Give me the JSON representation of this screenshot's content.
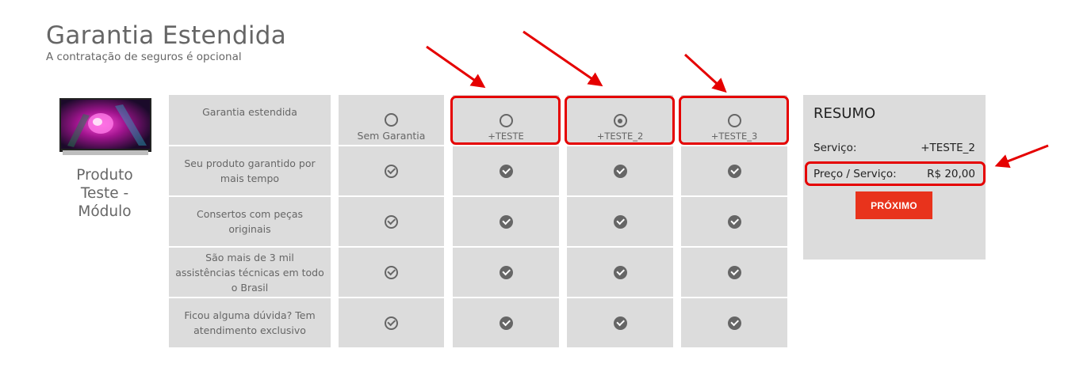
{
  "page": {
    "title": "Garantia Estendida",
    "subtitle": "A contratação de seguros é opcional"
  },
  "product": {
    "name": "Produto Teste - Módulo"
  },
  "features": [
    "Garantia estendida",
    "Seu produto garantido por mais tempo",
    "Consertos com peças originais",
    "São mais de 3 mil assistências técnicas em todo o Brasil",
    "Ficou alguma dúvida? Tem atendimento exclusivo"
  ],
  "options": [
    {
      "label": "Sem Garantia",
      "selected": false
    },
    {
      "label": "+TESTE",
      "selected": false
    },
    {
      "label": "+TESTE_2",
      "selected": true
    },
    {
      "label": "+TESTE_3",
      "selected": false
    }
  ],
  "summary": {
    "title": "RESUMO",
    "service_label": "Serviço:",
    "service_value": "+TESTE_2",
    "price_label": "Preço / Serviço:",
    "price_value": "R$ 20,00",
    "next_button": "PRÓXIMO"
  },
  "colors": {
    "accent": "#e8331c",
    "highlight": "#e50000",
    "panel": "#dcdcdc",
    "icon": "#666666"
  },
  "icons": {
    "check": "check-circle-icon",
    "radio": "radio-icon"
  }
}
